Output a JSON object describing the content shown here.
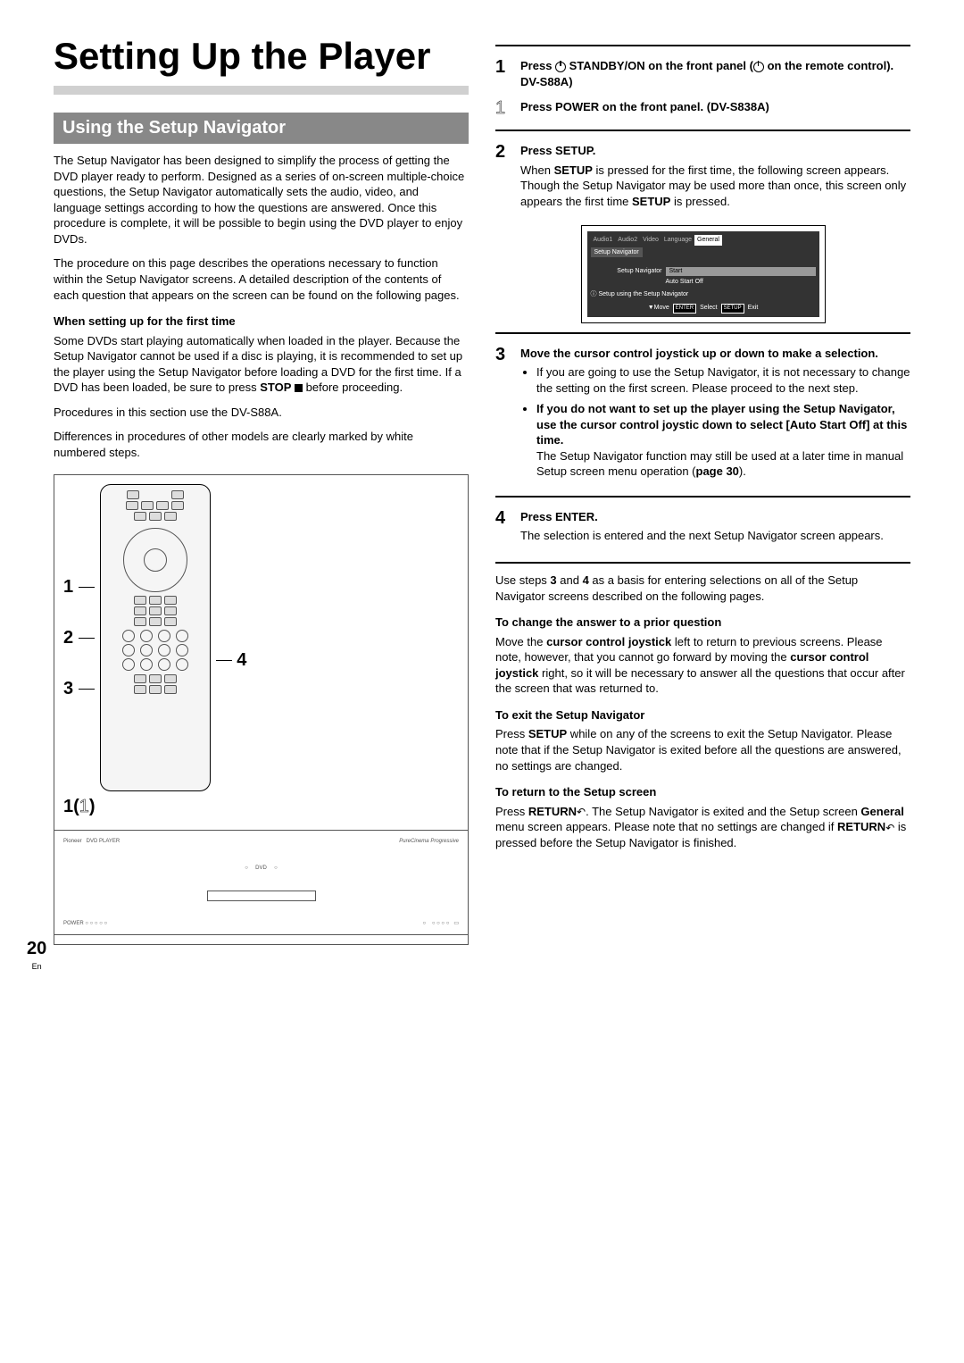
{
  "page": {
    "number": "20",
    "lang": "En"
  },
  "title": "Setting Up the Player",
  "section_banner": "Using the Setup Navigator",
  "intro1": "The Setup Navigator has been designed to simplify the process of getting the DVD player ready to perform. Designed as a series of on-screen multiple-choice questions, the Setup Navigator automatically sets the audio, video, and language settings according to how the questions are answered. Once this procedure is complete, it will be possible to begin using the DVD player to enjoy DVDs.",
  "intro2": "The procedure on this page describes the operations necessary to function within the Setup Navigator screens. A detailed description of the contents of each question that appears on the screen can be found on  the following pages.",
  "firsttime_heading": "When setting up for the first time",
  "firsttime_body_a": "Some DVDs start playing automatically when loaded in the player. Because the Setup Navigator cannot be used if a disc is playing, it is recommended to set up the player using the Setup Navigator before loading a DVD for the first time. If a DVD has been loaded, be sure to press ",
  "firsttime_body_stop": "STOP",
  "firsttime_body_b": " before proceeding.",
  "proc_note": "Procedures in this section use the DV-S88A.",
  "diff_note": "Differences in procedures of other models are clearly marked by white numbered steps.",
  "remote": {
    "callouts_left": [
      "1",
      "2",
      "3"
    ],
    "callout_right": "4",
    "panel_label_prefix": "1(",
    "panel_label_outline": "1",
    "panel_label_suffix": ")"
  },
  "steps": {
    "s1": {
      "num": "1",
      "heading_a": "Press ",
      "heading_b": " STANDBY/ON on the front panel (",
      "heading_c": " on the remote control). DV-S88A)"
    },
    "s1alt": {
      "num": "1",
      "heading": "Press  POWER on the front panel. (DV-S838A)"
    },
    "s2": {
      "num": "2",
      "heading": "Press SETUP.",
      "body_a": "When ",
      "body_b": "SETUP",
      "body_c": " is pressed for the first time, the following screen appears. Though the Setup Navigator may be used more than once, this screen only appears the first time ",
      "body_d": "SETUP",
      "body_e": " is pressed."
    },
    "s3": {
      "num": "3",
      "heading": "Move the cursor control joystick up or down to make a selection.",
      "bullet1": "If you are going to use the Setup Navigator, it is not necessary to change the setting on the first screen. Please proceed to the next step.",
      "bullet2_bold": "If you do not want to set up the player using the Setup Navigator, use the cursor control joystic down to select [Auto Start Off] at this time.",
      "bullet2_rest": "The Setup Navigator function may still be used at a later time in manual Setup screen menu operation (",
      "bullet2_page": "page 30",
      "bullet2_end": ")."
    },
    "s4": {
      "num": "4",
      "heading": "Press ENTER.",
      "body": "The selection is entered and the next Setup Navigator screen appears."
    }
  },
  "steps_footer": {
    "use_a": "Use steps ",
    "use_b": "3",
    "use_c": " and ",
    "use_d": "4",
    "use_e": " as a basis for entering selections on all of the Setup Navigator screens described on the following pages."
  },
  "change_heading": "To change the answer to a prior question",
  "change_body_a": "Move the ",
  "change_body_b": "cursor control joystick",
  "change_body_c": " left to return to previous screens. Please note, however, that you cannot go forward by moving the ",
  "change_body_d": "cursor control joystick",
  "change_body_e": " right, so it will be necessary to answer all the questions that occur after the screen that was returned to.",
  "exit_heading": "To exit the Setup Navigator",
  "exit_body_a": "Press ",
  "exit_body_b": "SETUP",
  "exit_body_c": " while on any of the screens to exit the Setup Navigator. Please note that if the Setup Navigator is exited before all the questions are answered, no settings are changed.",
  "return_heading": "To return to the Setup screen",
  "return_body_a": "Press ",
  "return_body_b": "RETURN",
  "return_body_c": ". The Setup Navigator is exited and the Setup screen ",
  "return_body_d": "General",
  "return_body_e": " menu screen appears. Please note that no settings are changed if ",
  "return_body_f": "RETURN",
  "return_body_g": " is pressed before the Setup Navigator is finished.",
  "screen": {
    "tabs": [
      "Audio1",
      "Audio2",
      "Video",
      "Language",
      "General"
    ],
    "subtab": "Setup Navigator",
    "menu_label": "Setup Navigator",
    "opt1": "Start",
    "opt2": "Auto Start Off",
    "info": "Setup using the Setup Navigator",
    "help_move": "Move",
    "help_enter": "ENTER",
    "help_select": "Select",
    "help_setup": "SETUP",
    "help_exit": "Exit"
  }
}
